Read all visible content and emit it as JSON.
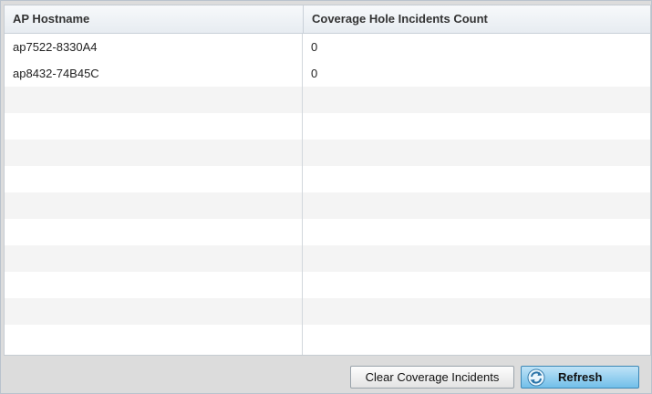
{
  "table": {
    "columns": [
      "AP Hostname",
      "Coverage Hole Incidents Count"
    ],
    "rows": [
      [
        "ap7522-8330A4",
        "0"
      ],
      [
        "ap8432-74B45C",
        "0"
      ]
    ]
  },
  "footer": {
    "clear_label": "Clear Coverage Incidents",
    "refresh_label": "Refresh",
    "refresh_icon": "refresh-icon"
  }
}
